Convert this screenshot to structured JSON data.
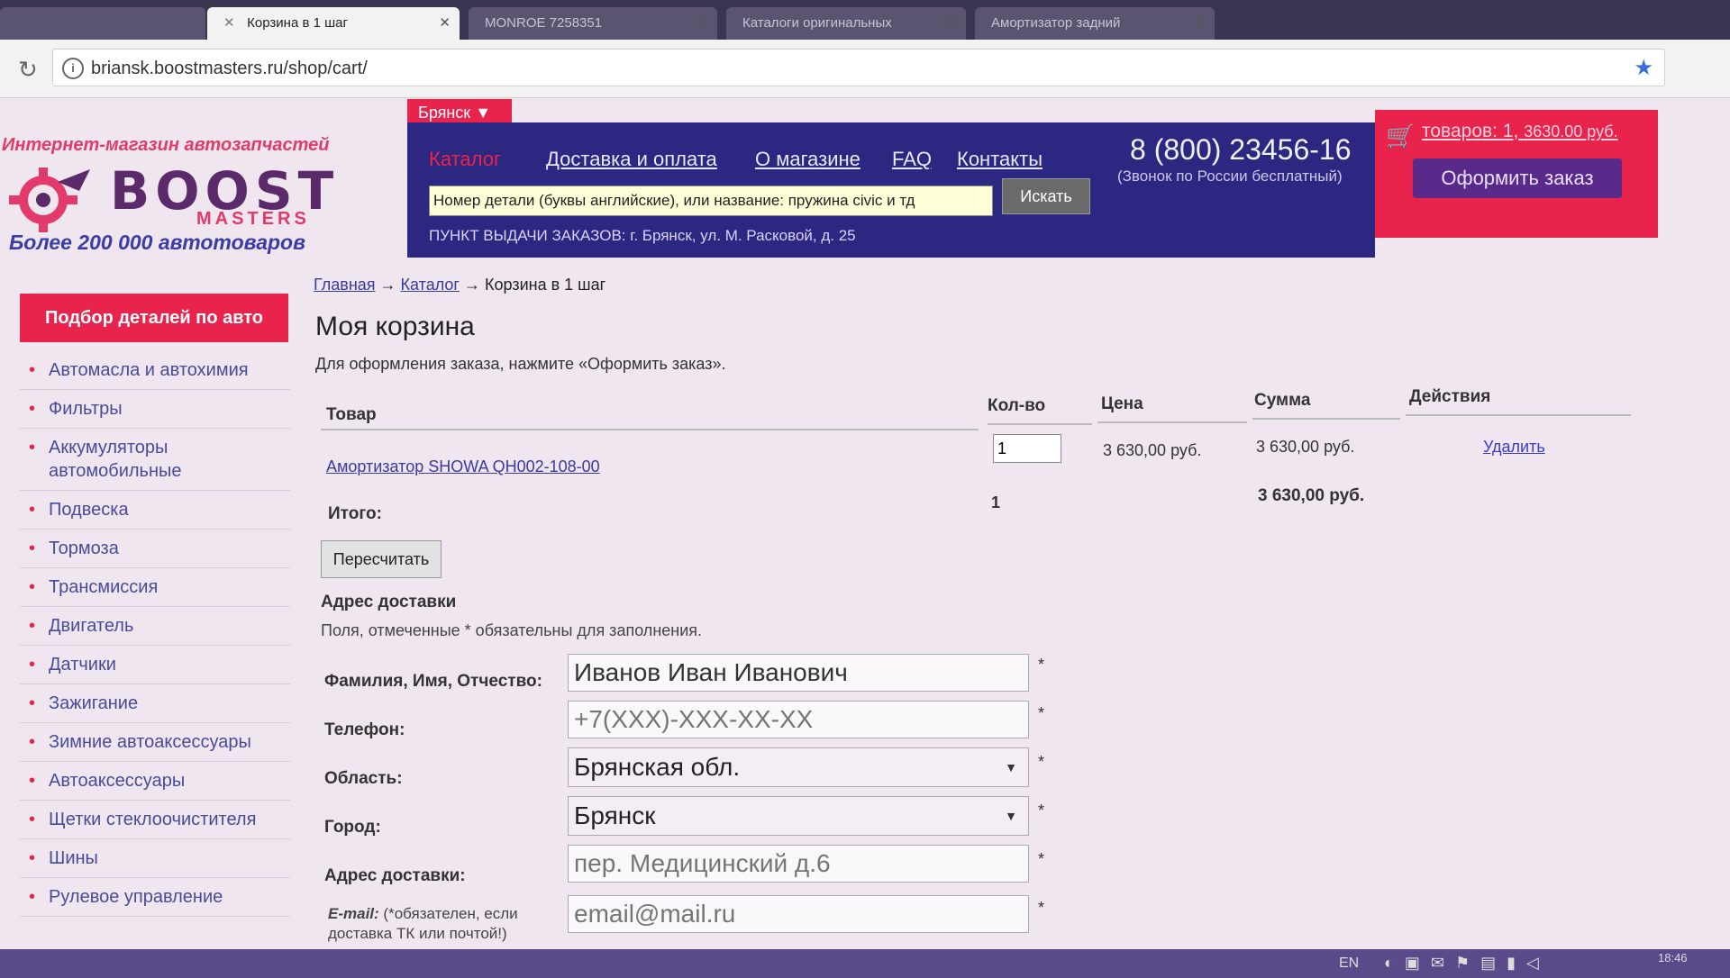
{
  "browser": {
    "tabs": [
      {
        "label": ""
      },
      {
        "label": "Корзина в 1 шаг"
      },
      {
        "label": "MONROE 7258351"
      },
      {
        "label": "Каталоги оригинальных"
      },
      {
        "label": "Амортизатор задний"
      }
    ],
    "url": "briansk.boostmasters.ru/shop/cart/"
  },
  "logo": {
    "tagline": "Интернет-магазин автозапчастей",
    "name": "BOOST",
    "name2": "MASTERS",
    "sub": "Более 200 000 автотоваров"
  },
  "header": {
    "city": "Брянск",
    "nav": [
      "Каталог",
      "Доставка и оплата",
      "О магазине",
      "FAQ",
      "Контакты"
    ],
    "search_value": "Номер детали (буквы английские), или название: пружина civic и тд",
    "search_button": "Искать",
    "pickup": "ПУНКТ ВЫДАЧИ ЗАКАЗОВ: г. Брянск, ул. М. Расковой, д. 25",
    "phone": "8 (800) 23456-16",
    "phone_note": "(Звонок по России бесплатный)",
    "cart_link": "товаров: 1,",
    "cart_sum": "3630.00 руб.",
    "checkout": "Оформить заказ"
  },
  "sidebar": {
    "title": "Подбор деталей по авто",
    "items": [
      {
        "label": "Автомасла и автохимия"
      },
      {
        "label": "Фильтры"
      },
      {
        "label": "Аккумуляторы автомобильные"
      },
      {
        "label": "Подвеска"
      },
      {
        "label": "Тормоза"
      },
      {
        "label": "Трансмиссия"
      },
      {
        "label": "Двигатель"
      },
      {
        "label": "Датчики"
      },
      {
        "label": "Зажигание"
      },
      {
        "label": "Зимние автоаксессуары"
      },
      {
        "label": "Автоаксессуары"
      },
      {
        "label": "Щетки стеклоочистителя"
      },
      {
        "label": "Шины"
      },
      {
        "label": "Рулевое управление"
      }
    ]
  },
  "breadcrumb": {
    "home": "Главная",
    "catalog": "Каталог",
    "current": "Корзина в 1 шаг",
    "sep": "→"
  },
  "cart": {
    "title": "Моя корзина",
    "intro": "Для оформления заказа, нажмите «Оформить заказ».",
    "headers": {
      "product": "Товар",
      "qty": "Кол-во",
      "price": "Цена",
      "sum": "Сумма",
      "actions": "Действия"
    },
    "row": {
      "product": "Амортизатор SHOWA QH002-108-00",
      "qty": "1",
      "price": "3 630,00 руб.",
      "sum": "3 630,00 руб.",
      "delete": "Удалить"
    },
    "total_label": "Итого:",
    "total_qty": "1",
    "total_sum": "3 630,00 руб.",
    "recalc": "Пересчитать"
  },
  "delivery": {
    "title": "Адрес доставки",
    "note": "Поля, отмеченные * обязательны для заполнения.",
    "fields": {
      "fio_label": "Фамилия, Имя, Отчество:",
      "fio_value": "Иванов Иван Иванович",
      "phone_label": "Телефон:",
      "phone_placeholder": "+7(XXX)-XXX-XX-XX",
      "region_label": "Область:",
      "region_value": "Брянская обл.",
      "city_label": "Город:",
      "city_value": "Брянск",
      "address_label": "Адрес доставки:",
      "address_placeholder": "пер. Медицинский д.6",
      "email_label": "E-mail:",
      "email_note": "(*обязателен, если доставка ТК или почтой!)",
      "email_placeholder": "email@mail.ru"
    },
    "required_mark": "*"
  },
  "taskbar": {
    "lang": "EN",
    "time": "18:46"
  },
  "colors": {
    "brand_red": "#e8244c",
    "header_blue": "#2c2780",
    "link": "#3a3aa0"
  }
}
